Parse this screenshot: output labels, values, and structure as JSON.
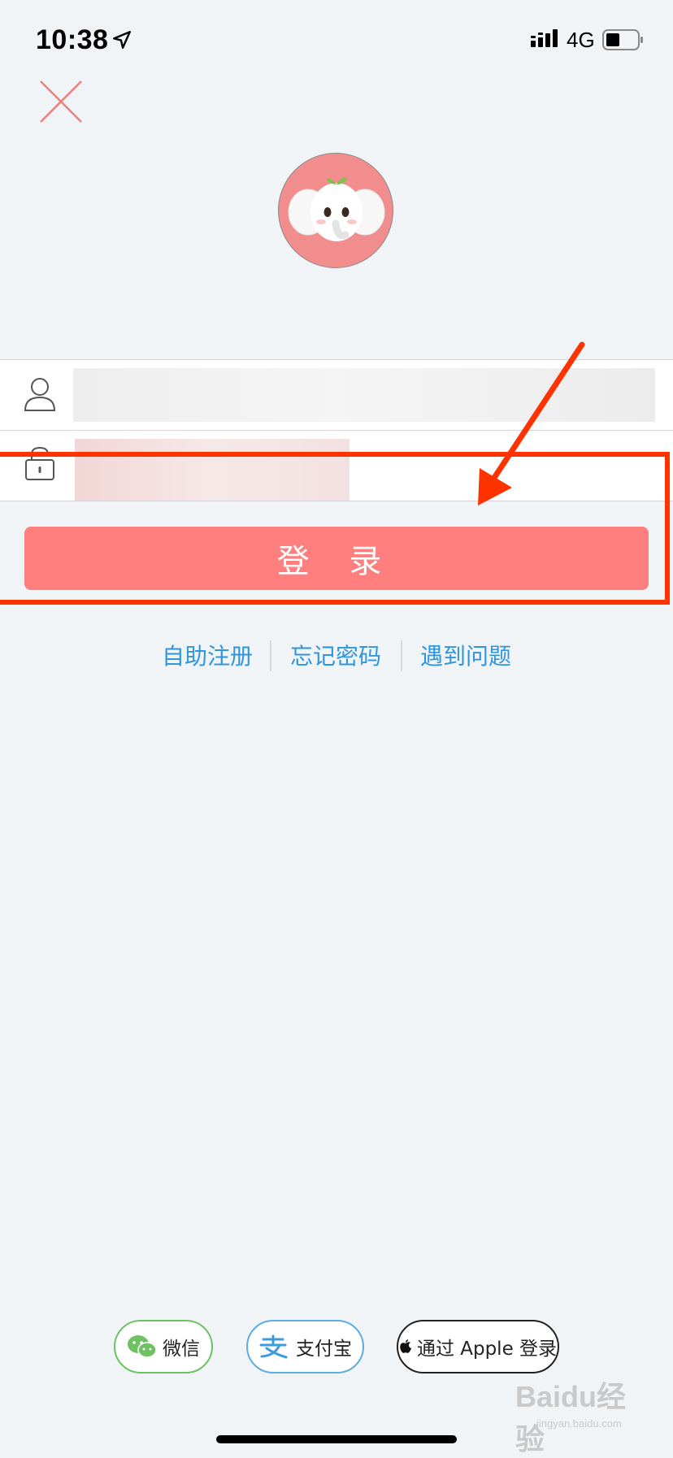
{
  "status_bar": {
    "time": "10:38",
    "network": "4G"
  },
  "login_form": {
    "username_placeholder": "",
    "password_placeholder": "",
    "login_label": "登 录"
  },
  "links": {
    "register": "自助注册",
    "forgot_password": "忘记密码",
    "problem": "遇到问题"
  },
  "social_login": {
    "wechat": "微信",
    "alipay": "支付宝",
    "apple": "通过 Apple 登录"
  },
  "watermark": {
    "brand": "Baidu经验",
    "url": "jingyan.baidu.com"
  },
  "colors": {
    "accent": "#ff7e7e",
    "link": "#2f95dd",
    "annotation": "#ff3300",
    "background": "#f1f4f6"
  },
  "icons": [
    "location-arrow-icon",
    "signal-icon",
    "battery-icon",
    "close-icon",
    "elephant-avatar",
    "user-icon",
    "lock-icon",
    "wechat-icon",
    "alipay-icon",
    "apple-icon"
  ]
}
